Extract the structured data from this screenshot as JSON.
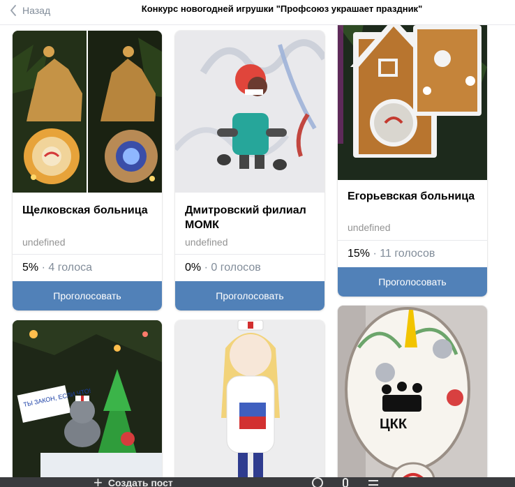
{
  "header": {
    "back_label": "Назад",
    "title": "Конкурс новогодней игрушки \"Профсоюз украшает праздник\""
  },
  "cards": [
    {
      "name": "Щелковская больница",
      "subtitle": "undefined",
      "percent": "5%",
      "votes": "4 голоса",
      "button": "Проголосовать"
    },
    {
      "name": "Дмитровский филиал МОМК",
      "subtitle": "undefined",
      "percent": "0%",
      "votes": "0 голосов",
      "button": "Проголосовать"
    },
    {
      "name": "Егорьевская больница",
      "subtitle": "undefined",
      "percent": "15%",
      "votes": "11 голосов",
      "button": "Проголосовать"
    }
  ],
  "photo_texts": {
    "sign": "ТЫ ЗАКОН, ЕСЛИ ЧТО!",
    "ornament_text": "ЦКК"
  },
  "toolbar": {
    "create_post_label": "Создать пост"
  },
  "colors": {
    "accent": "#5181b8",
    "header_title": "#000000",
    "muted": "#818c99",
    "toolbar_bg": "#3a3b3e"
  }
}
